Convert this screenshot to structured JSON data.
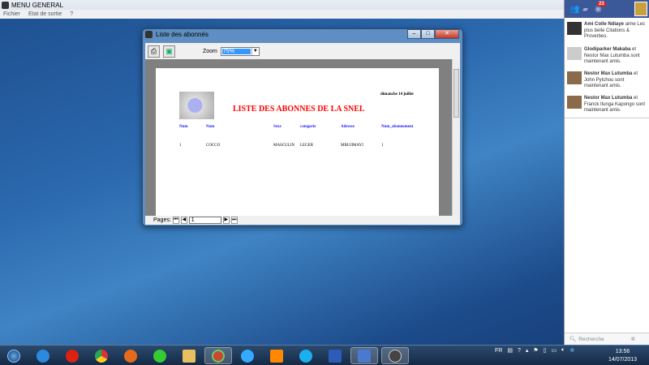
{
  "main_window": {
    "title": "MENU GENERAL",
    "menu": [
      "Fichier",
      "Etat de sortie",
      "?"
    ]
  },
  "report_window": {
    "title": "Liste des abonnés",
    "zoom_label": "Zoom",
    "zoom_value": "75%",
    "pages_label": "Pages:",
    "page_value": "1",
    "report": {
      "date": "dimanche 14 juillet",
      "title": "LISTE DES ABONNES DE LA SNEL",
      "title_color": "#ff0000",
      "columns": [
        "Num",
        "Nom",
        "Sexe",
        "categorie",
        "Adresse",
        "Num_abonnement"
      ],
      "rows": [
        [
          "1",
          "COCCO",
          "MASCULIN",
          "LEGER",
          "MBUJIMAYI",
          "1"
        ]
      ]
    }
  },
  "facebook": {
    "notification_count": "23",
    "items": [
      {
        "name": "Ami Colle Ndiaye",
        "text": "aime Les plus belle Citations & Proverbes."
      },
      {
        "name": "Glodiparker Makaba",
        "text": "et Nestor Max Lutumba sont maintenant amis."
      },
      {
        "name": "Nestor Max Lutumba",
        "text": "et John Pytchou sont maintenant amis."
      },
      {
        "name": "Nestor Max Lutumba",
        "text": "et Franck Ilunga Kapongo sont maintenant amis."
      }
    ],
    "search_placeholder": "Recherche"
  },
  "taskbar": {
    "language": "FR",
    "time": "13:56",
    "date": "14/07/2013",
    "apps": [
      "start",
      "internet-explorer",
      "opera",
      "chrome",
      "firefox",
      "green-app",
      "file-explorer",
      "app",
      "media-player",
      "vlc",
      "skype",
      "word",
      "active-app",
      "app-current"
    ]
  }
}
